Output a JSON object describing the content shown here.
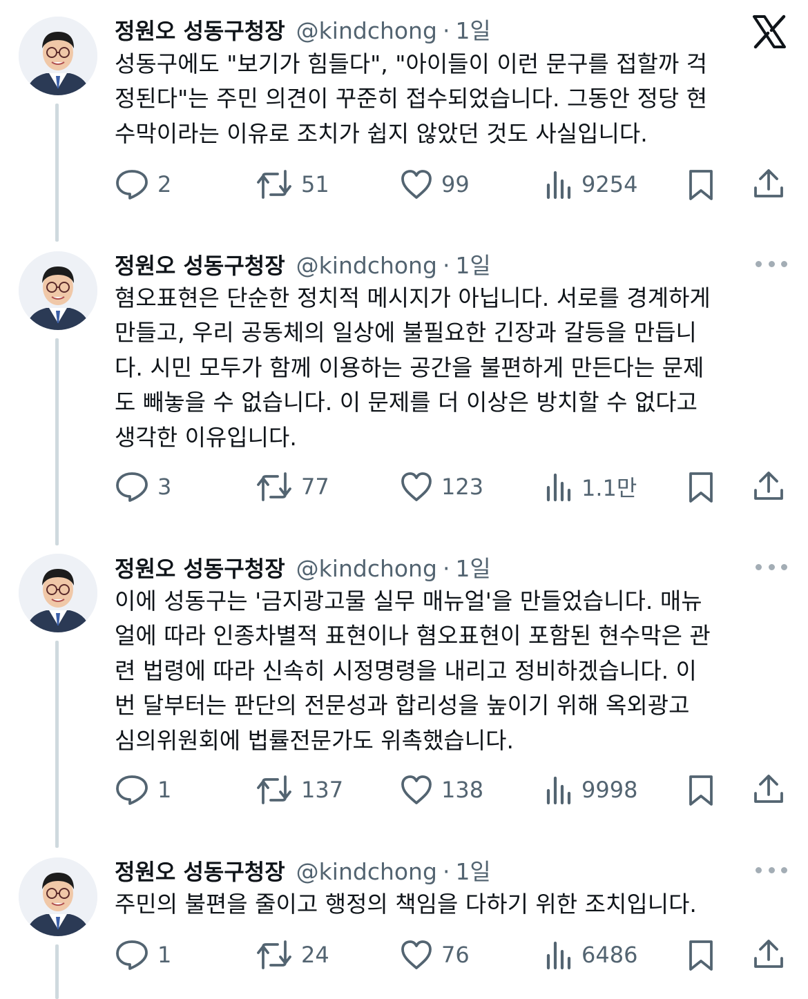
{
  "author": {
    "name": "정원오 성동구청장",
    "handle": "@kindchong"
  },
  "logo_icon": "x-logo-icon",
  "colors": {
    "text": "#0f1419",
    "secondary": "#536471",
    "thread_line": "#cfd9de"
  },
  "tweets": [
    {
      "time": "1일",
      "text_lines": [
        "성동구에도 \"보기가 힘들다\", \"아이들이 이런 문구를 접할까 걱",
        "정된다\"는 주민 의견이 꾸준히 접수되었습니다. 그동안 정당 현",
        "수막이라는 이유로 조치가 쉽지 않았던 것도 사실입니다."
      ],
      "replies": "2",
      "reposts": "51",
      "likes": "99",
      "views": "9254"
    },
    {
      "time": "1일",
      "text_lines": [
        "혐오표현은 단순한 정치적 메시지가 아닙니다. 서로를 경계하게",
        "만들고, 우리 공동체의 일상에 불필요한 긴장과 갈등을 만듭니",
        "다. 시민 모두가 함께 이용하는 공간을 불편하게 만든다는 문제",
        "도 빼놓을 수 없습니다. 이 문제를 더 이상은 방치할 수 없다고",
        "생각한 이유입니다."
      ],
      "replies": "3",
      "reposts": "77",
      "likes": "123",
      "views": "1.1만"
    },
    {
      "time": "1일",
      "text_lines": [
        "이에 성동구는 '금지광고물 실무 매뉴얼'을 만들었습니다. 매뉴",
        "얼에 따라 인종차별적 표현이나 혐오표현이 포함된 현수막은 관",
        "련 법령에 따라 신속히 시정명령을 내리고 정비하겠습니다. 이",
        "번 달부터는 판단의 전문성과 합리성을 높이기 위해 옥외광고",
        "심의위원회에 법률전문가도 위촉했습니다."
      ],
      "replies": "1",
      "reposts": "137",
      "likes": "138",
      "views": "9998"
    },
    {
      "time": "1일",
      "text_lines": [
        "주민의 불편을 줄이고 행정의 책임을 다하기 위한 조치입니다."
      ],
      "replies": "1",
      "reposts": "24",
      "likes": "76",
      "views": "6486"
    }
  ]
}
